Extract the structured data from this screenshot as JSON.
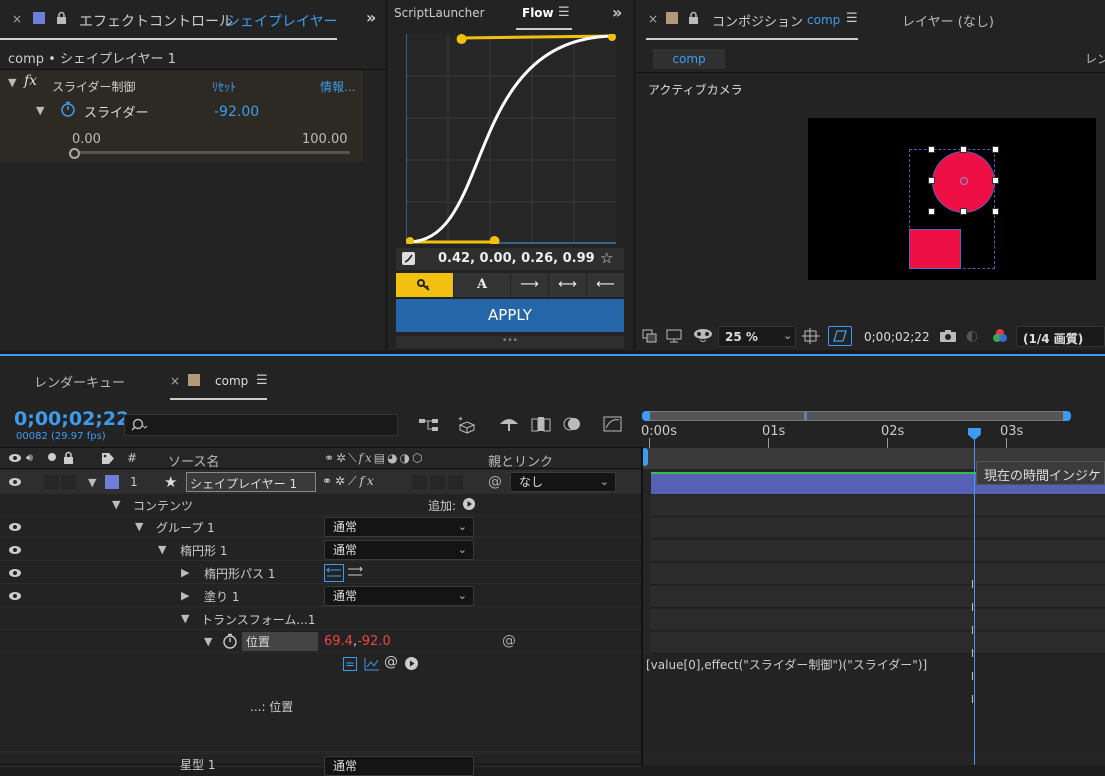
{
  "effect_panel": {
    "tab_title": "エフェクトコントロール",
    "tab_layer": "シェイプレイヤー 1",
    "subtitle": "comp • シェイプレイヤー 1",
    "effect_name": "スライダー制御",
    "reset": "ﾘｾｯﾄ",
    "info": "情報...",
    "param_name": "スライダー",
    "param_value": "-92.00",
    "slider_min": "0.00",
    "slider_max": "100.00"
  },
  "flow_panel": {
    "tab_script": "ScriptLauncher",
    "tab_flow": "Flow",
    "curve_values": "0.42, 0.00, 0.26, 0.99",
    "apply": "APPLY",
    "handle_tool_a": "A",
    "curve": {
      "x1": 0.42,
      "y1": 0.0,
      "x2": 0.26,
      "y2": 0.99
    }
  },
  "comp_panel": {
    "tab_label": "コンポジション",
    "tab_name": "comp",
    "layer_tab": "レイヤー (なし)",
    "subtab": "comp",
    "subtab_right": "レン",
    "camera": "アクティブカメラ",
    "zoom": "25 %",
    "timecode": "0;00;02;22",
    "quality": "(1/4 画質)",
    "colors": {
      "shape": "#ee1045",
      "accent": "#3d9cf0"
    }
  },
  "timeline": {
    "tab_render": "レンダーキュー",
    "tab_comp": "comp",
    "timecode": "0;00;02;22",
    "fps_line": "00082 (29.97 fps)",
    "col_source": "ソース名",
    "col_parent": "親とリンク",
    "ruler": [
      "0:00s",
      "01s",
      "02s",
      "03s"
    ],
    "playhead_time": 2.73,
    "tooltip": "現在の時間インジケ",
    "layer": {
      "num": "1",
      "name": "シェイプレイヤー 1",
      "parent": "なし"
    },
    "contents": "コンテンツ",
    "add": "追加:",
    "group": "グループ 1",
    "group_mode": "通常",
    "ellipse": "楕円形 1",
    "ellipse_mode": "通常",
    "ellipse_path": "楕円形パス 1",
    "fill": "塗り 1",
    "fill_mode": "通常",
    "transform": "トランスフォーム...1",
    "position_label": "位置",
    "position_x": "69.4",
    "position_y": "-92.0",
    "position_comma": ",",
    "expr_caption": "...: 位置",
    "expression": "[value[0],effect(\"スライダー制御\")(\"スライダー\")]",
    "bottom_name": "星型 1",
    "bottom_mode": "通常"
  }
}
